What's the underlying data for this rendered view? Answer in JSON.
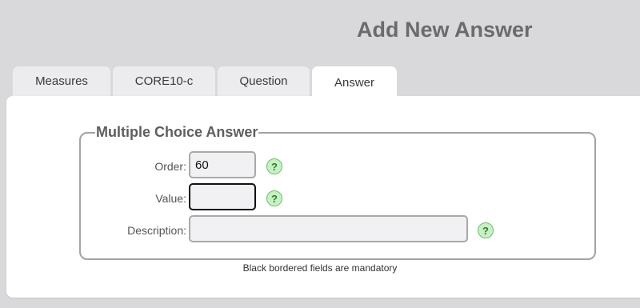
{
  "page": {
    "title": "Add New Answer"
  },
  "tabs": [
    {
      "label": "Measures",
      "active": false
    },
    {
      "label": "CORE10-c",
      "active": false
    },
    {
      "label": "Question",
      "active": false
    },
    {
      "label": "Answer",
      "active": true
    }
  ],
  "form": {
    "legend": "Multiple Choice Answer",
    "fields": {
      "order": {
        "label": "Order:",
        "value": "60",
        "mandatory": false
      },
      "value": {
        "label": "Value:",
        "value": "",
        "mandatory": true
      },
      "description": {
        "label": "Description:",
        "value": "",
        "mandatory": false
      }
    },
    "help_icon": "question-mark-icon",
    "help_glyph": "?",
    "note": "Black bordered fields are mandatory"
  },
  "colors": {
    "background": "#d9d9dc",
    "panel": "#ffffff",
    "help_green": "#c7f0c5",
    "mandatory_border": "#111111"
  }
}
